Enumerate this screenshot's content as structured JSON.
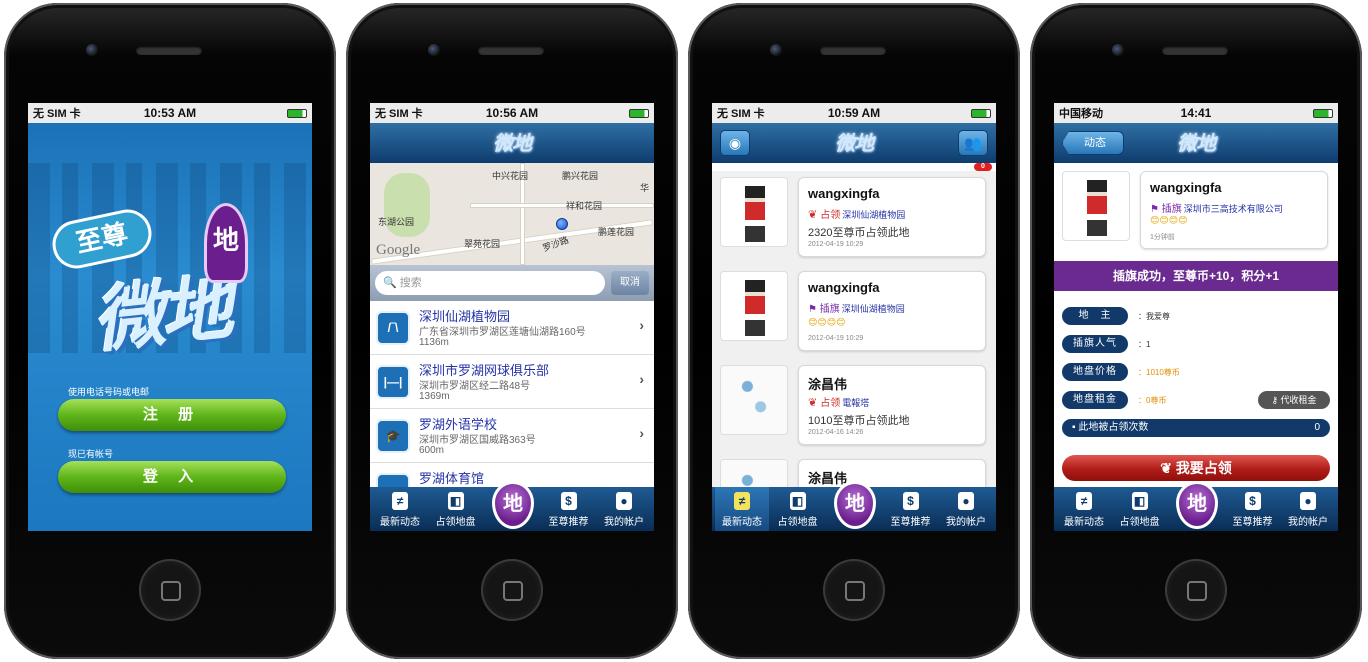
{
  "screens": [
    {
      "status": {
        "carrier": "无 SIM 卡",
        "time": "10:53 AM"
      },
      "logo": {
        "badge": "至尊",
        "word": "微地",
        "pin": "地"
      },
      "register": {
        "hint": "使用电话号码或电邮",
        "button": "注 册"
      },
      "login": {
        "hint": "现已有帐号",
        "button": "登 入"
      }
    },
    {
      "status": {
        "carrier": "无 SIM 卡",
        "time": "10:56 AM"
      },
      "map": {
        "labels": [
          "中兴花园",
          "鹏兴花园",
          "祥和花园",
          "东湖公园",
          "翠苑花园",
          "鹏莲花园",
          "罗沙路",
          "华"
        ],
        "logo": "Google"
      },
      "search": {
        "placeholder": "搜索",
        "cancel": "取消"
      },
      "places": [
        {
          "name": "深圳仙湖植物园",
          "address": "广东省深圳市罗湖区莲塘仙湖路160号",
          "distance": "1136m"
        },
        {
          "name": "深圳市罗湖网球俱乐部",
          "address": "深圳市罗湖区经二路48号",
          "distance": "1369m"
        },
        {
          "name": "罗湖外语学校",
          "address": "深圳市罗湖区国威路363号",
          "distance": "600m"
        },
        {
          "name": "罗湖体育馆",
          "address": "",
          "distance": ""
        }
      ]
    },
    {
      "status": {
        "carrier": "无 SIM 卡",
        "time": "10:59 AM"
      },
      "badge": "0",
      "feed": [
        {
          "user": "wangxingfa",
          "action": "占领",
          "place": "深圳仙湖植物园",
          "desc": "2320至尊币占领此地",
          "smileys": "",
          "time": "2012-04-19 10:29"
        },
        {
          "user": "wangxingfa",
          "action": "插旗",
          "place": "深圳仙湖植物园",
          "desc": "",
          "smileys": "😊😊😊😊",
          "time": "2012-04-19 10:29"
        },
        {
          "user": "涂昌伟",
          "action": "占领",
          "place": "電報塔",
          "desc": "1010至尊币占领此地",
          "smileys": "",
          "time": "2012-04-16 14:26"
        },
        {
          "user": "涂昌伟",
          "action": "",
          "place": "",
          "desc": "",
          "smileys": "",
          "time": ""
        }
      ]
    },
    {
      "status": {
        "carrier": "中国移动",
        "time": "14:41"
      },
      "back": "动态",
      "profile": {
        "user": "wangxingfa",
        "action": "插旗",
        "company": "深圳市三高技术有限公司",
        "smileys": "😊😊😊😊",
        "time": "1分钟前"
      },
      "success": "插旗成功，至尊币+10，积分+1",
      "fields": [
        {
          "label": "地　主",
          "value": "我爱尊"
        },
        {
          "label": "插旗人气",
          "value": "1"
        },
        {
          "label": "地盘价格",
          "value": "1010尊币"
        },
        {
          "label": "地盘租金",
          "value": "0尊币"
        }
      ],
      "rent_button": "代收租金",
      "count": {
        "label": "此地被占领次数",
        "value": "0"
      },
      "occupy_button": "我要占领"
    }
  ],
  "tabs": {
    "t1": "最新动态",
    "t2": "占领地盘",
    "t4": "至尊推荐",
    "t5": "我的帐户",
    "center": "地"
  },
  "colors": {
    "brand_blue": "#0f3c6e",
    "accent_purple": "#6a2a8f",
    "green": "#5fb51a",
    "red": "#b01d19"
  }
}
